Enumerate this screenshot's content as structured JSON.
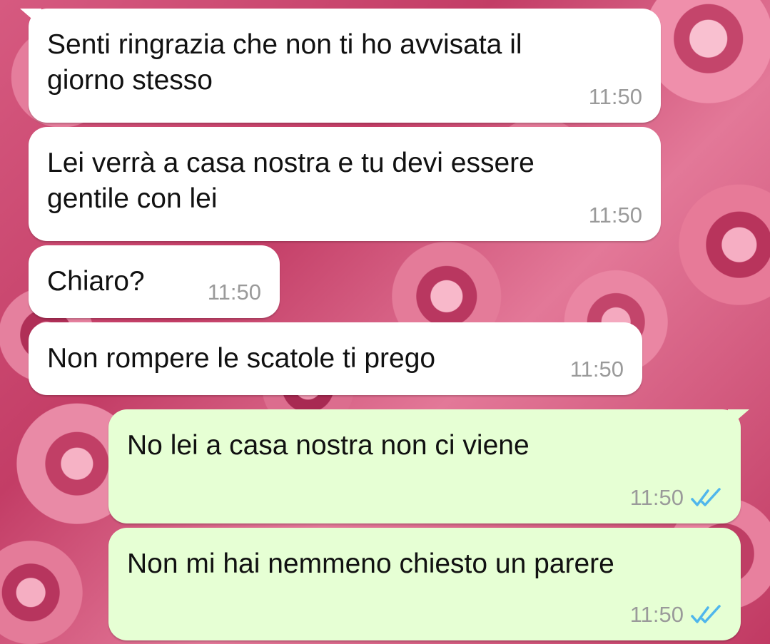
{
  "messages": [
    {
      "direction": "in",
      "text": "Senti ringrazia che non ti ho avvisata il\ngiorno stesso",
      "time": "11:50"
    },
    {
      "direction": "in",
      "text": "Lei verrà a casa nostra e tu devi essere\ngentile con lei",
      "time": "11:50"
    },
    {
      "direction": "in",
      "text": "Chiaro?",
      "time": "11:50"
    },
    {
      "direction": "in",
      "text": "Non rompere le scatole ti prego",
      "time": "11:50"
    },
    {
      "direction": "out",
      "text": "No lei a casa nostra non ci viene",
      "time": "11:50",
      "status": "read"
    },
    {
      "direction": "out",
      "text": "Non mi hai nemmeno chiesto un parere",
      "time": "11:50",
      "status": "read"
    }
  ],
  "colors": {
    "incoming_bubble": "#ffffff",
    "outgoing_bubble": "#e6ffd4",
    "read_ticks": "#4fb6ec",
    "timestamp": "#9a9a9a",
    "wallpaper": "#d14a72"
  },
  "icons": {
    "read_status": "double-check-icon",
    "wallpaper": "roses-wallpaper"
  }
}
